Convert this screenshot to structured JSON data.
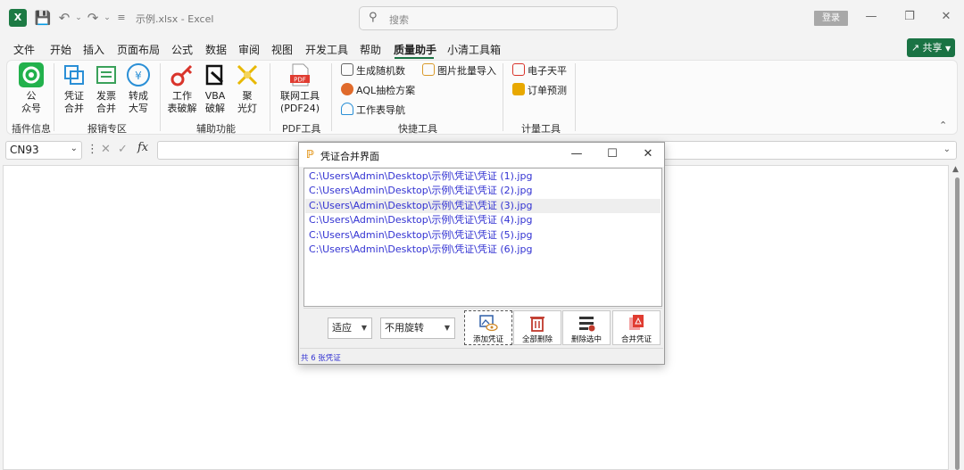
{
  "titlebar": {
    "app_icon": "excel-logo",
    "doc_title": "示例.xlsx  -  Excel",
    "search_placeholder": "搜索",
    "login_label": "登录"
  },
  "menu": {
    "items": [
      "文件",
      "开始",
      "插入",
      "页面布局",
      "公式",
      "数据",
      "审阅",
      "视图",
      "开发工具",
      "帮助",
      "质量助手",
      "小清工具箱"
    ],
    "active": "质量助手",
    "share_label": "共享"
  },
  "ribbon": {
    "plugin_info": {
      "label_l1": "公",
      "label_l2": "众号",
      "group": "插件信息"
    },
    "reimburse": {
      "btn1_l1": "凭证",
      "btn1_l2": "合并",
      "btn2_l1": "发票",
      "btn2_l2": "合并",
      "btn3_l1": "转成",
      "btn3_l2": "大写",
      "group": "报销专区"
    },
    "assist": {
      "btn1_l1": "工作",
      "btn1_l2": "表破解",
      "btn2_l1": "VBA",
      "btn2_l2": "破解",
      "btn3_l1": "聚",
      "btn3_l2": "光灯",
      "group": "辅助功能"
    },
    "pdf": {
      "btn_l1": "联网工具",
      "btn_l2": "(PDF24)",
      "group": "PDF工具",
      "icon_text": "PDF"
    },
    "quick": {
      "items": [
        "生成随机数",
        "AQL抽检方案",
        "工作表导航",
        "图片批量导入"
      ],
      "group": "快捷工具"
    },
    "measure": {
      "items": [
        "电子天平",
        "订单预测"
      ],
      "group": "计量工具"
    }
  },
  "formula_bar": {
    "name_box": "CN93",
    "fx_label": "fx"
  },
  "dialog": {
    "title": "凭证合并界面",
    "files": [
      "C:\\Users\\Admin\\Desktop\\示例\\凭证\\凭证 (1).jpg",
      "C:\\Users\\Admin\\Desktop\\示例\\凭证\\凭证 (2).jpg",
      "C:\\Users\\Admin\\Desktop\\示例\\凭证\\凭证 (3).jpg",
      "C:\\Users\\Admin\\Desktop\\示例\\凭证\\凭证 (4).jpg",
      "C:\\Users\\Admin\\Desktop\\示例\\凭证\\凭证 (5).jpg",
      "C:\\Users\\Admin\\Desktop\\示例\\凭证\\凭证 (6).jpg"
    ],
    "selected_index": 2,
    "fit_select": "适应",
    "rotate_select": "不用旋转",
    "buttons": {
      "add": "添加凭证",
      "delete_all": "全部删除",
      "delete_selected": "删除选中",
      "merge": "合并凭证"
    },
    "status": "共 6 张凭证"
  },
  "colors": {
    "excel_green": "#1a7344",
    "file_text": "#3232d2",
    "selected_row": "#eeeeee",
    "delete_red": "#c0392b",
    "pdf_red": "#e03c31"
  }
}
